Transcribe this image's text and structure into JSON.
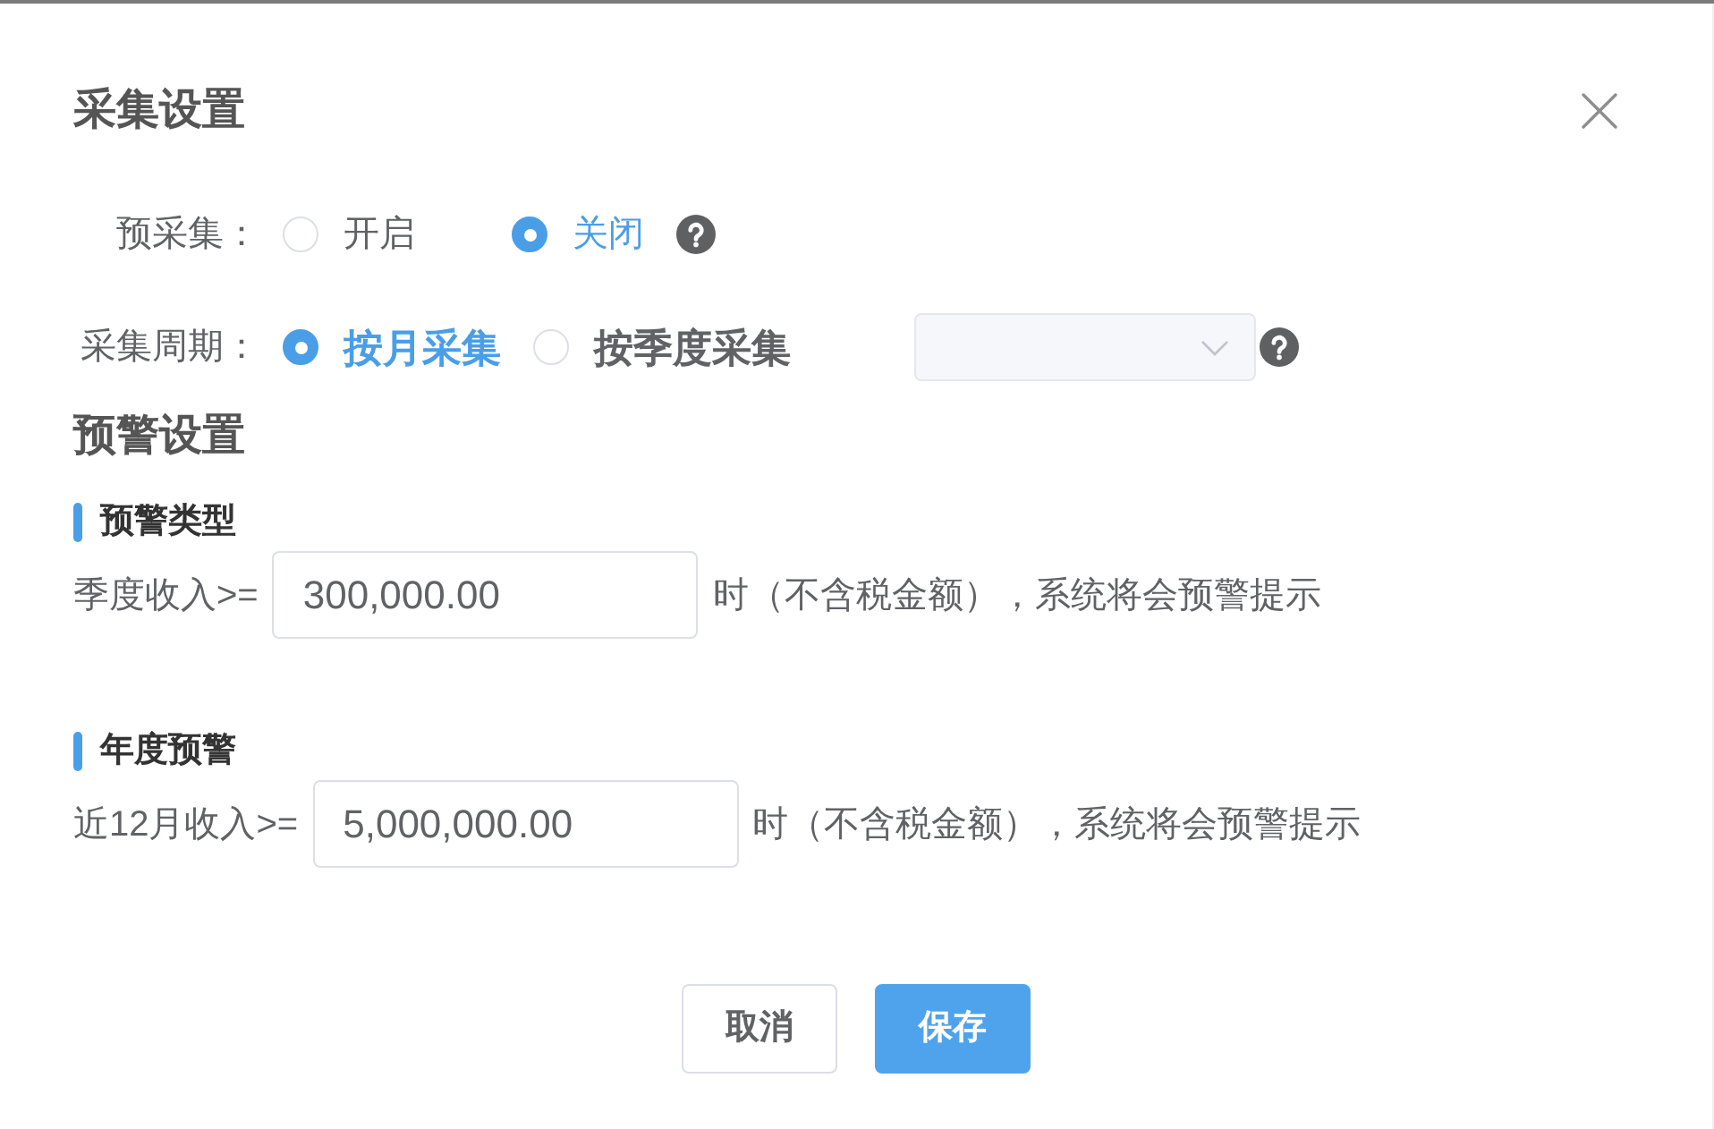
{
  "dialog": {
    "title": "采集设置"
  },
  "pre_collect": {
    "label": "预采集：",
    "options": [
      {
        "label": "开启",
        "selected": false
      },
      {
        "label": "关闭",
        "selected": true
      }
    ]
  },
  "collect_period": {
    "label": "采集周期：",
    "options": [
      {
        "label": "按月采集",
        "selected": true
      },
      {
        "label": "按季度采集",
        "selected": false
      }
    ],
    "select": {
      "disabled": true
    }
  },
  "warning_settings": {
    "title": "预警设置",
    "groups": [
      {
        "title": "预警类型",
        "label": "季度收入>=",
        "value": "300,000.00",
        "note": "时（不含税金额），系统将会预警提示"
      },
      {
        "title": "年度预警",
        "label": "近12月收入>=",
        "value": "5,000,000.00",
        "note": "时（不含税金额），系统将会预警提示"
      }
    ]
  },
  "buttons": [
    {
      "label": "取消",
      "kind": "default"
    },
    {
      "label": "保存",
      "kind": "primary"
    }
  ]
}
